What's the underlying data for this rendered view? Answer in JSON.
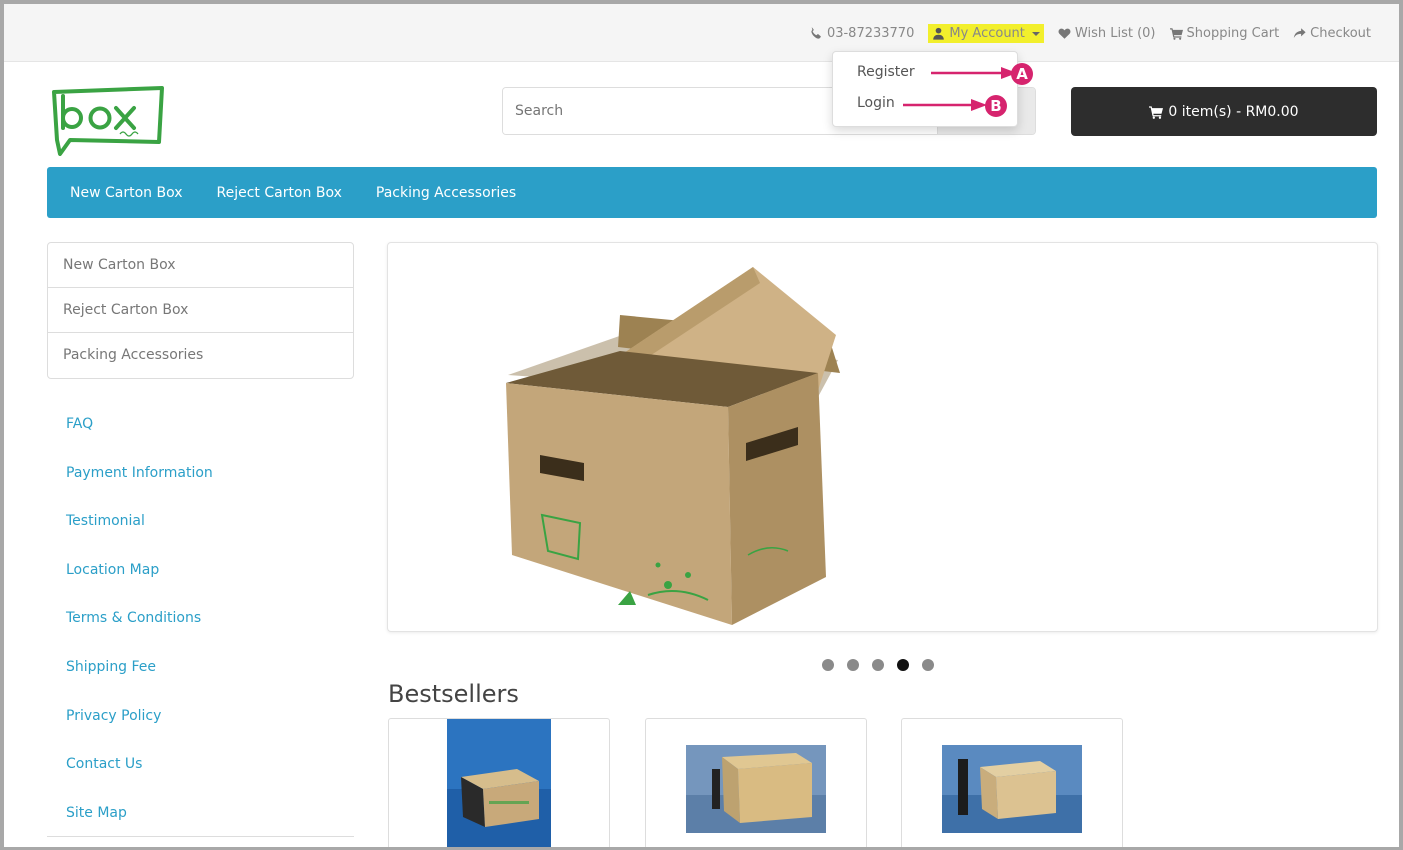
{
  "topbar": {
    "phone": "03-87233770",
    "account_label": "My Account",
    "wishlist": "Wish List (0)",
    "cart": "Shopping Cart",
    "checkout": "Checkout"
  },
  "account_menu": {
    "register": "Register",
    "login": "Login",
    "annotation_a": "A",
    "annotation_b": "B"
  },
  "search": {
    "placeholder": "Search"
  },
  "cart_button": "0 item(s) - RM0.00",
  "menu": [
    "New Carton Box",
    "Reject Carton Box",
    "Packing Accessories"
  ],
  "categories": [
    "New Carton Box",
    "Reject Carton Box",
    "Packing Accessories"
  ],
  "info_links": [
    "FAQ",
    "Payment Information",
    "Testimonial",
    "Location Map",
    "Terms & Conditions",
    "Shipping Fee",
    "Privacy Policy",
    "Contact Us",
    "Site Map"
  ],
  "slider": {
    "count": 5,
    "active_index": 3
  },
  "bestsellers_title": "Bestsellers",
  "colors": {
    "menu": "#2b9fc8",
    "highlight": "#f2ef2c",
    "annotation": "#d6246e",
    "logo": "#3aa343",
    "cart_button": "#2d2d2d"
  }
}
